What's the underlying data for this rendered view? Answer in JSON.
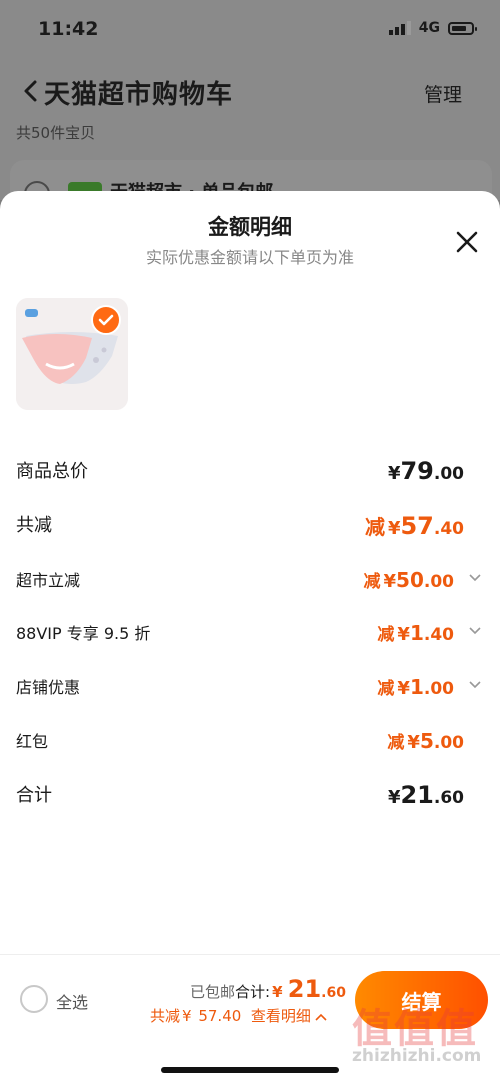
{
  "status_bar": {
    "time": "11:42",
    "network": "4G"
  },
  "cart_header": {
    "title": "天猫超市购物车",
    "manage_label": "管理",
    "item_count": "共50件宝贝",
    "store_name": "天猫超市 · 单品包邮"
  },
  "sheet": {
    "title": "金额明细",
    "subtitle": "实际优惠金额请以下单页为准",
    "rows": {
      "total_price": {
        "label": "商品总价",
        "currency": "¥",
        "int": "79",
        "dec": ".00"
      },
      "total_reduce": {
        "label": "共减",
        "prefix": "减",
        "currency": "¥",
        "int": "57",
        "dec": ".40"
      },
      "supermarket": {
        "label": "超市立减",
        "prefix": "减",
        "currency": "¥",
        "int": "50",
        "dec": ".00"
      },
      "vip": {
        "label": "88VIP 专享 9.5 折",
        "prefix": "减",
        "currency": "¥",
        "int": "1",
        "dec": ".40"
      },
      "store": {
        "label": "店铺优惠",
        "prefix": "减",
        "currency": "¥",
        "int": "1",
        "dec": ".00"
      },
      "redpacket": {
        "label": "红包",
        "prefix": "减",
        "currency": "¥",
        "int": "5",
        "dec": ".00"
      },
      "sum": {
        "label": "合计",
        "currency": "¥",
        "int": "21",
        "dec": ".60"
      }
    }
  },
  "bottom_bar": {
    "select_all": "全选",
    "shipped": "已包邮",
    "total_label": "合计:",
    "total_currency": "¥",
    "total_int": "21",
    "total_dec": ".60",
    "discount_prefix": "共减",
    "discount_currency": "¥",
    "discount_value": "57.40",
    "view_detail": "查看明细",
    "checkout": "结算"
  },
  "watermark": {
    "logo": "值值值",
    "text": "zhizhizhi.com"
  },
  "colors": {
    "accent": "#ee5a0e",
    "button_start": "#ff8a00",
    "button_end": "#ff5000"
  }
}
